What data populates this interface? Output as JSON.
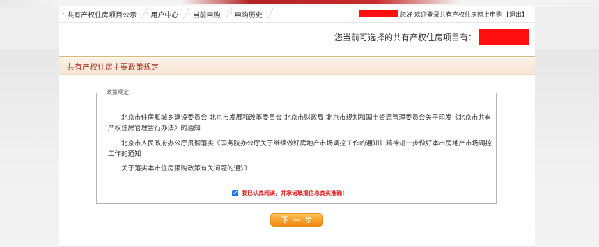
{
  "nav": {
    "items": [
      {
        "label": "共有产权住房项目公示"
      },
      {
        "label": "用户中心"
      },
      {
        "label": "当前申购"
      },
      {
        "label": "申购历史"
      }
    ],
    "welcome_text": "您好 欢迎登录共有产权住房网上申购",
    "logout_label": "【退出】"
  },
  "project_count_label": "您当前可选择的共有产权住房项目有：",
  "section": {
    "title": "共有产权住房主要政策规定"
  },
  "policy": {
    "legend": "政策规定",
    "items": [
      {
        "text": "北京市住房和城乡建设委员会 北京市发展和改革委员会 北京市财政局 北京市规划和国土资源管理委员会关于印发《北京市共有产权住房管理暂行办法》的通知"
      },
      {
        "text": "北京市人民政府办公厅贯彻落实《国务院办公厅关于继续做好房地产市场调控工作的通知》精神进一步做好本市房地产市场调控工作的通知"
      },
      {
        "text": "关于落实本市住房限购政策有关问题的通知"
      }
    ]
  },
  "agreement": {
    "label": "我已认真阅读，并承诺填报信息真实准确！",
    "checked": true
  },
  "next_button_label": "下一步",
  "colors": {
    "accent_red": "#b0342a",
    "warning_red": "#e0201a",
    "button_orange": "#f8a12b",
    "gold_divider": "#d9b97a",
    "redaction": "#ff1010"
  }
}
